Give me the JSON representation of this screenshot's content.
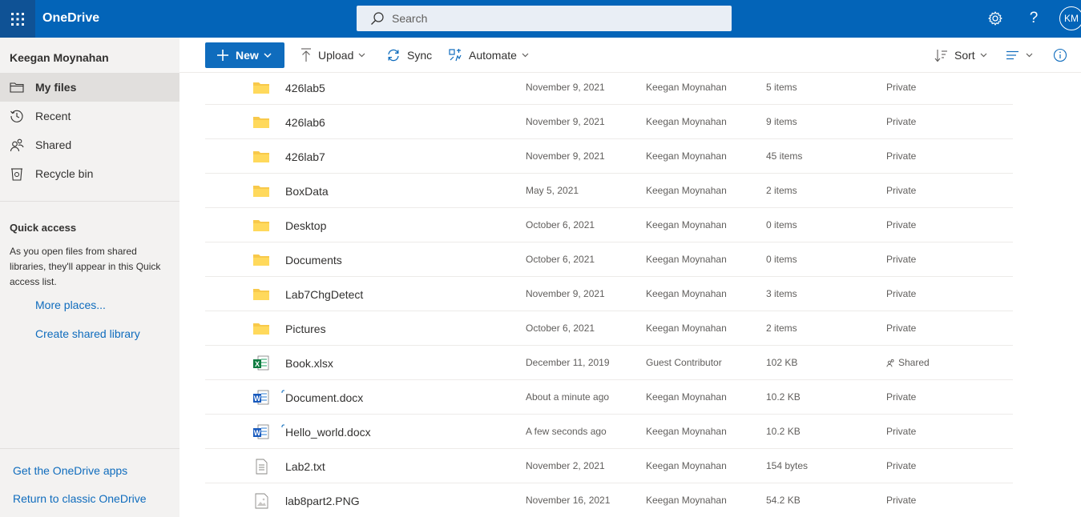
{
  "app": {
    "brand": "OneDrive",
    "search_placeholder": "Search",
    "avatar_initials": "KM"
  },
  "sidebar": {
    "user_name": "Keegan Moynahan",
    "items": [
      {
        "label": "My files",
        "icon": "folder-icon",
        "active": true
      },
      {
        "label": "Recent",
        "icon": "clock-icon"
      },
      {
        "label": "Shared",
        "icon": "people-icon"
      },
      {
        "label": "Recycle bin",
        "icon": "recycle-bin-icon"
      }
    ],
    "quick_access_title": "Quick access",
    "quick_access_text": "As you open files from shared libraries, they'll appear in this Quick access list.",
    "more_places": "More places...",
    "create_shared_library": "Create shared library",
    "get_apps": "Get the OneDrive apps",
    "return_classic": "Return to classic OneDrive"
  },
  "toolbar": {
    "new_label": "New",
    "upload_label": "Upload",
    "sync_label": "Sync",
    "automate_label": "Automate",
    "sort_label": "Sort"
  },
  "files": [
    {
      "name": "426lab5",
      "type": "folder",
      "modified": "November 9, 2021",
      "modified_by": "Keegan Moynahan",
      "size": "5 items",
      "sharing": "Private"
    },
    {
      "name": "426lab6",
      "type": "folder",
      "modified": "November 9, 2021",
      "modified_by": "Keegan Moynahan",
      "size": "9 items",
      "sharing": "Private"
    },
    {
      "name": "426lab7",
      "type": "folder",
      "modified": "November 9, 2021",
      "modified_by": "Keegan Moynahan",
      "size": "45 items",
      "sharing": "Private"
    },
    {
      "name": "BoxData",
      "type": "folder",
      "modified": "May 5, 2021",
      "modified_by": "Keegan Moynahan",
      "size": "2 items",
      "sharing": "Private"
    },
    {
      "name": "Desktop",
      "type": "folder",
      "modified": "October 6, 2021",
      "modified_by": "Keegan Moynahan",
      "size": "0 items",
      "sharing": "Private"
    },
    {
      "name": "Documents",
      "type": "folder",
      "modified": "October 6, 2021",
      "modified_by": "Keegan Moynahan",
      "size": "0 items",
      "sharing": "Private"
    },
    {
      "name": "Lab7ChgDetect",
      "type": "folder",
      "modified": "November 9, 2021",
      "modified_by": "Keegan Moynahan",
      "size": "3 items",
      "sharing": "Private"
    },
    {
      "name": "Pictures",
      "type": "folder",
      "modified": "October 6, 2021",
      "modified_by": "Keegan Moynahan",
      "size": "2 items",
      "sharing": "Private"
    },
    {
      "name": "Book.xlsx",
      "type": "excel",
      "modified": "December 11, 2019",
      "modified_by": "Guest Contributor",
      "size": "102 KB",
      "sharing": "Shared"
    },
    {
      "name": "Document.docx",
      "type": "word",
      "modified": "About a minute ago",
      "modified_by": "Keegan Moynahan",
      "size": "10.2 KB",
      "sharing": "Private",
      "new": true
    },
    {
      "name": "Hello_world.docx",
      "type": "word",
      "modified": "A few seconds ago",
      "modified_by": "Keegan Moynahan",
      "size": "10.2 KB",
      "sharing": "Private",
      "new": true
    },
    {
      "name": "Lab2.txt",
      "type": "text",
      "modified": "November 2, 2021",
      "modified_by": "Keegan Moynahan",
      "size": "154 bytes",
      "sharing": "Private"
    },
    {
      "name": "lab8part2.PNG",
      "type": "image",
      "modified": "November 16, 2021",
      "modified_by": "Keegan Moynahan",
      "size": "54.2 KB",
      "sharing": "Private"
    }
  ],
  "colors": {
    "topbar": "#0364b8",
    "accent": "#0f6cbd",
    "folder": "#f8c94b",
    "sidebar": "#f3f2f1"
  }
}
